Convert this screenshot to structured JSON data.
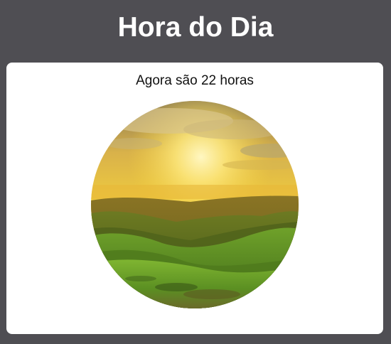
{
  "header": {
    "title": "Hora do Dia"
  },
  "card": {
    "message": "Agora são 22 horas",
    "image": {
      "subject": "sunrise over green rolling hills",
      "shape": "circle"
    }
  },
  "colors": {
    "page_background": "#4f4e53",
    "card_background": "#ffffff",
    "title_color": "#ffffff",
    "text_color": "#111111"
  }
}
